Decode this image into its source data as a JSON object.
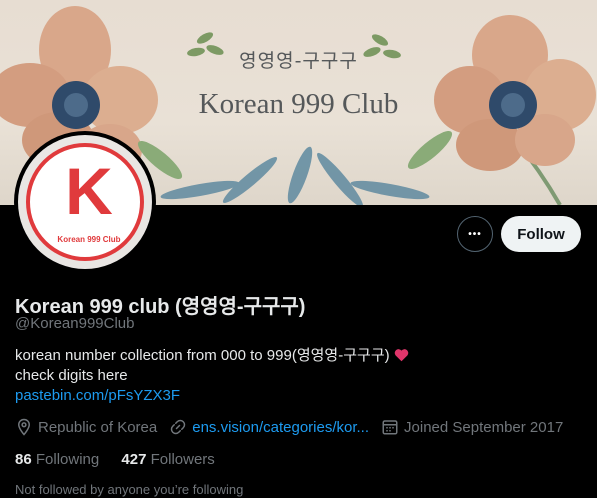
{
  "banner": {
    "title_kr": "영영영-구구구",
    "title_en": "Korean 999 Club"
  },
  "avatar": {
    "letter": "K",
    "caption": "Korean 999 Club",
    "accent": "#e03a3c"
  },
  "actions": {
    "more_label": "•••",
    "follow_label": "Follow"
  },
  "profile": {
    "display_name": "Korean 999 club (영영영-구구구)",
    "handle": "@Korean999Club",
    "bio_line1": "korean number collection from 000 to 999(영영영-구구구)",
    "bio_line2": "check digits here",
    "bio_link": "pastebin.com/pFsYZX3F",
    "location": "Republic of Korea",
    "website": "ens.vision/categories/kor...",
    "joined": "Joined September 2017",
    "following_count": "86",
    "following_label": "Following",
    "followers_count": "427",
    "followers_label": "Followers",
    "not_followed": "Not followed by anyone you’re following"
  },
  "icons": [
    "more-icon",
    "heart-emoji-icon",
    "location-pin-icon",
    "link-icon",
    "calendar-icon"
  ],
  "colors": {
    "link": "#1d9bf0",
    "muted": "#71767b",
    "background": "#000000"
  }
}
